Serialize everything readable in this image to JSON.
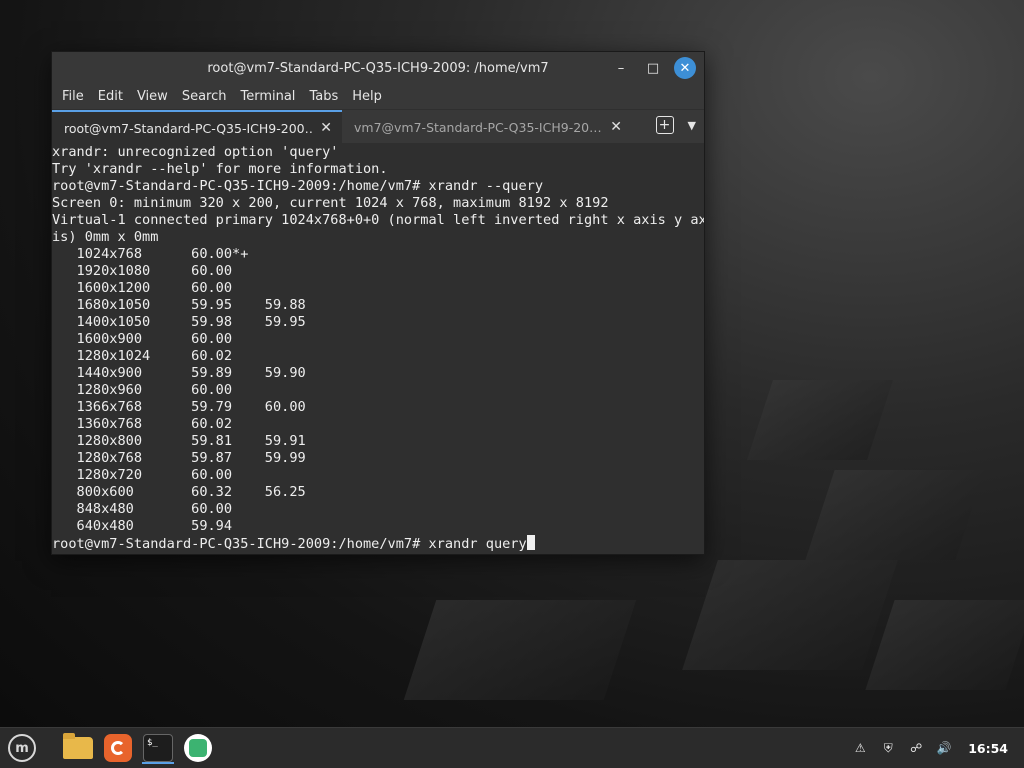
{
  "window": {
    "title": "root@vm7-Standard-PC-Q35-ICH9-2009: /home/vm7",
    "minimize_glyph": "–",
    "maximize_glyph": "□",
    "close_glyph": "✕"
  },
  "menu": [
    "File",
    "Edit",
    "View",
    "Search",
    "Terminal",
    "Tabs",
    "Help"
  ],
  "tabs": [
    {
      "label": "root@vm7-Standard-PC-Q35-ICH9-200…",
      "active": true
    },
    {
      "label": "vm7@vm7-Standard-PC-Q35-ICH9-20…",
      "active": false
    }
  ],
  "terminal": {
    "lines": [
      "xrandr: unrecognized option 'query'",
      "Try 'xrandr --help' for more information.",
      "root@vm7-Standard-PC-Q35-ICH9-2009:/home/vm7# xrandr --query",
      "Screen 0: minimum 320 x 200, current 1024 x 768, maximum 8192 x 8192",
      "Virtual-1 connected primary 1024x768+0+0 (normal left inverted right x axis y ax",
      "is) 0mm x 0mm",
      "   1024x768      60.00*+",
      "   1920x1080     60.00",
      "   1600x1200     60.00",
      "   1680x1050     59.95    59.88",
      "   1400x1050     59.98    59.95",
      "   1600x900      60.00",
      "   1280x1024     60.02",
      "   1440x900      59.89    59.90",
      "   1280x960      60.00",
      "   1366x768      59.79    60.00",
      "   1360x768      60.02",
      "   1280x800      59.81    59.91",
      "   1280x768      59.87    59.99",
      "   1280x720      60.00",
      "   800x600       60.32    56.25",
      "   848x480       60.00",
      "   640x480       59.94"
    ],
    "prompt": "root@vm7-Standard-PC-Q35-ICH9-2009:/home/vm7# xrandr query"
  },
  "panel": {
    "menu_icon": "mint-menu-icon",
    "launchers": [
      "files-icon",
      "firefox-icon",
      "terminal-icon",
      "calculator-icon"
    ],
    "terminal_icon_text": "$_",
    "tray": [
      "update-icon",
      "shield-icon",
      "network-icon",
      "volume-icon"
    ],
    "clock": "16:54"
  }
}
